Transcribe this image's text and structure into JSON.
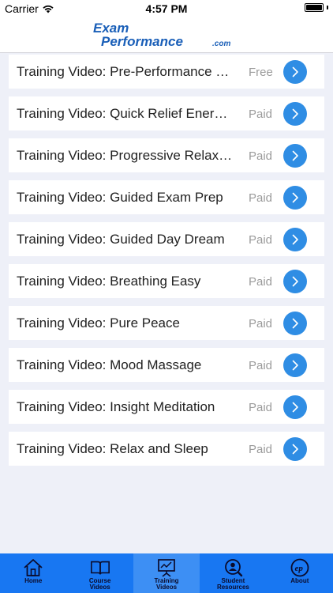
{
  "status_bar": {
    "carrier": "Carrier",
    "time": "4:57 PM"
  },
  "header": {
    "logo_line1": "Exam",
    "logo_line2": "Performance",
    "logo_suffix": ".com"
  },
  "list": {
    "items": [
      {
        "title": "Training Video: Pre-Performance Checklist",
        "price": "Free"
      },
      {
        "title": "Training Video: Quick Relief Energizer",
        "price": "Paid"
      },
      {
        "title": "Training Video: Progressive Relaxation",
        "price": "Paid"
      },
      {
        "title": "Training Video: Guided Exam Prep",
        "price": "Paid"
      },
      {
        "title": "Training Video: Guided Day Dream",
        "price": "Paid"
      },
      {
        "title": "Training Video: Breathing Easy",
        "price": "Paid"
      },
      {
        "title": "Training Video: Pure Peace",
        "price": "Paid"
      },
      {
        "title": "Training Video: Mood Massage",
        "price": "Paid"
      },
      {
        "title": "Training Video: Insight Meditation",
        "price": "Paid"
      },
      {
        "title": "Training Video: Relax and Sleep",
        "price": "Paid"
      }
    ]
  },
  "tabbar": {
    "tabs": [
      {
        "line1": "Home",
        "line2": "",
        "icon": "house-icon"
      },
      {
        "line1": "Course",
        "line2": "Videos",
        "icon": "book-icon"
      },
      {
        "line1": "Training",
        "line2": "Videos",
        "icon": "presentation-board-icon"
      },
      {
        "line1": "Student",
        "line2": "Resources",
        "icon": "magnifier-person-icon"
      },
      {
        "line1": "About",
        "line2": "",
        "icon": "ep-logo-icon"
      }
    ],
    "active_index": 2
  },
  "colors": {
    "accent": "#2f8de4",
    "tabbar": "#1877f2",
    "tab_active": "#3d8ff4",
    "logo_blue": "#1a5fb8"
  }
}
